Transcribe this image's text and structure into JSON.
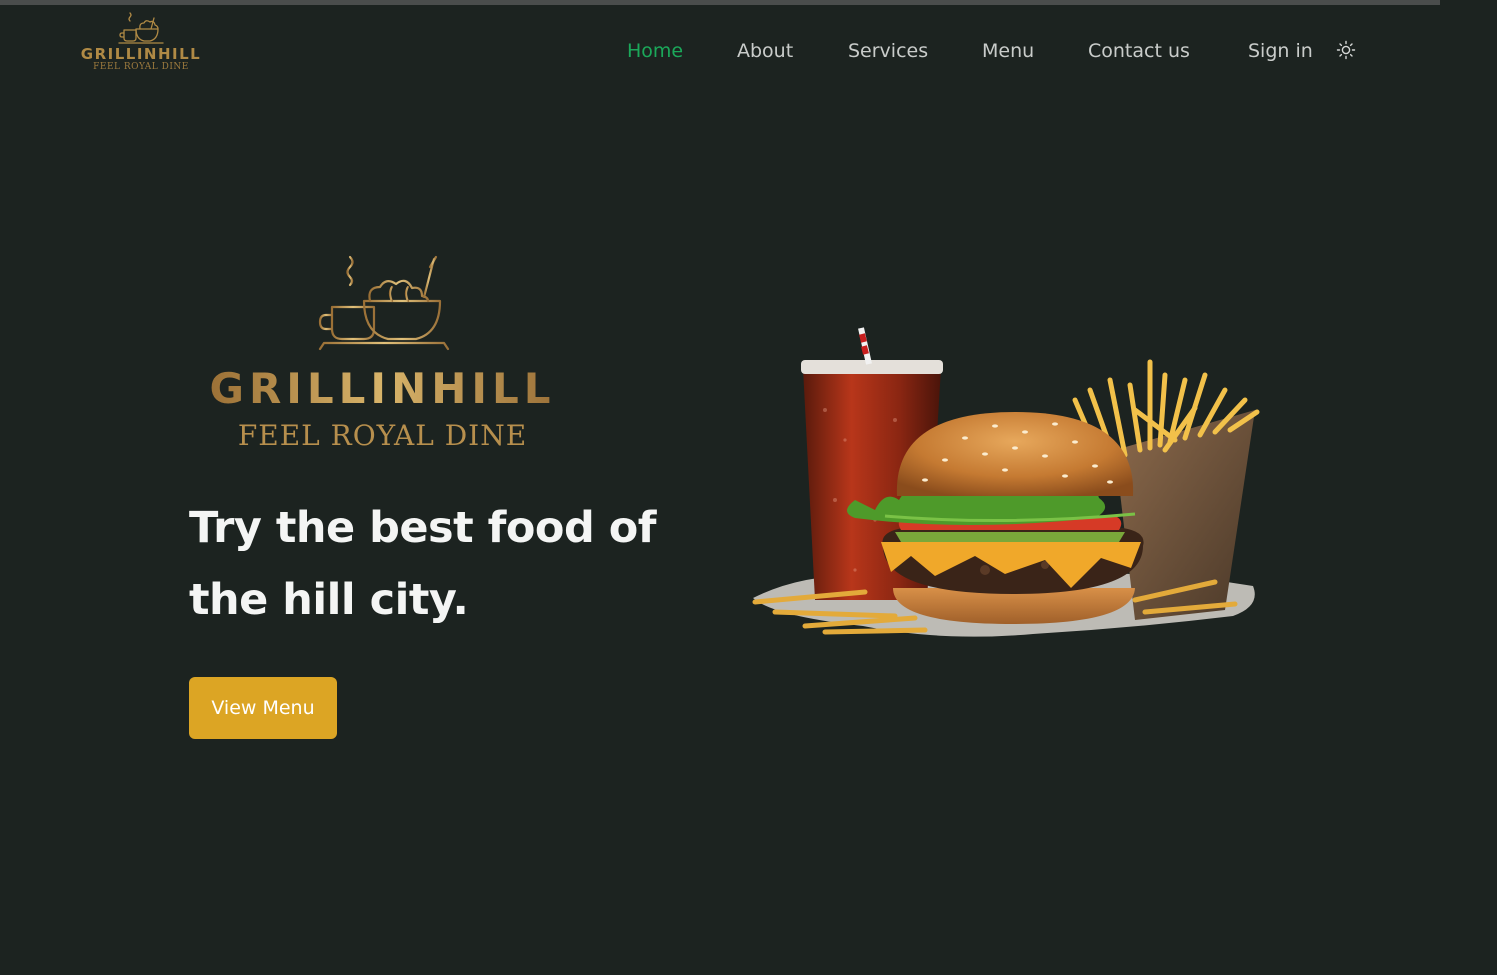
{
  "nav": {
    "logo": {
      "brand": "GRILLINHILL",
      "tagline": "FEEL ROYAL DINE"
    },
    "links": [
      {
        "label": "Home",
        "active": true
      },
      {
        "label": "About",
        "active": false
      },
      {
        "label": "Services",
        "active": false
      },
      {
        "label": "Menu",
        "active": false
      },
      {
        "label": "Contact us",
        "active": false
      },
      {
        "label": "Sign in",
        "active": false
      }
    ],
    "theme_icon": "sun-icon"
  },
  "hero": {
    "logo": {
      "brand": "GRILLINHILL",
      "tagline": "FEEL ROYAL DINE",
      "icon": "cup-and-bowl-icon"
    },
    "headline": "Try the best food of the hill city.",
    "cta_label": "View Menu",
    "image": "burger-fries-drink-image"
  },
  "colors": {
    "background": "#1c2320",
    "active_link": "#1ba85a",
    "link": "#c9ccca",
    "gold": "#b08a45",
    "button": "#dca524"
  }
}
